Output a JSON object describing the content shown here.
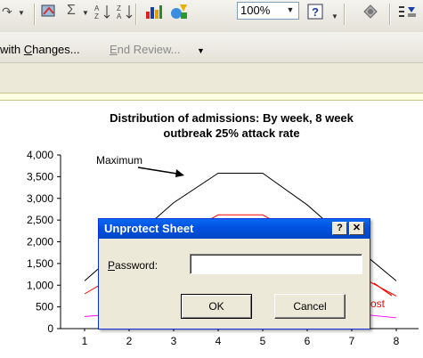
{
  "toolbar": {
    "zoom_value": "100%",
    "icons": [
      "redo-icon",
      "drawing-icon",
      "sum-icon",
      "sort-ascending-icon",
      "sort-descending-icon",
      "chart-wizard-icon",
      "drawing-tools-icon",
      "help-icon",
      "research-icon",
      "format-icon"
    ]
  },
  "review_toolbar": {
    "reply_prefix": "with ",
    "reply_accel": "C",
    "reply_rest": "hanges...",
    "end_accel": "E",
    "end_rest": "nd Review..."
  },
  "chart": {
    "title_line1": "Distribution of admissions: By week, 8 week",
    "title_line2": "outbreak 25% attack rate",
    "annotation_max": "Maximum",
    "annotation_right": "ost"
  },
  "chart_data": {
    "type": "line",
    "title": "Distribution of admissions: By week, 8 week outbreak 25% attack rate",
    "x": [
      1,
      2,
      3,
      4,
      5,
      6,
      7,
      8
    ],
    "yticks": [
      "0",
      "500",
      "1,000",
      "1,500",
      "2,000",
      "2,500",
      "3,000",
      "3,500",
      "4,000"
    ],
    "ylim": [
      0,
      4000
    ],
    "series": [
      {
        "name": "Maximum",
        "color": "#000000",
        "values": [
          1100,
          2000,
          2900,
          3580,
          3580,
          2850,
          1950,
          1100
        ]
      },
      {
        "name": "",
        "color": "#ff0000",
        "values": [
          800,
          1400,
          2050,
          2620,
          2620,
          2050,
          1300,
          750
        ]
      },
      {
        "name": "",
        "color": "#ff00ff",
        "values": [
          280,
          350,
          440,
          530,
          530,
          450,
          350,
          250
        ]
      }
    ]
  },
  "dialog": {
    "title": "Unprotect Sheet",
    "help_label": "?",
    "close_label": "✕",
    "password_accel": "P",
    "password_rest": "assword:",
    "password_value": "",
    "ok_label": "OK",
    "cancel_label": "Cancel"
  }
}
